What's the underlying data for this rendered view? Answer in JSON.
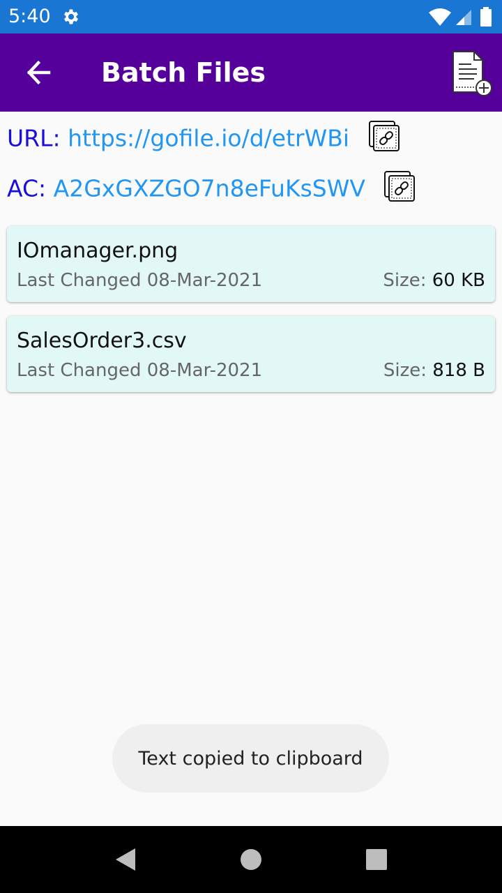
{
  "status_bar": {
    "time": "5:40",
    "icons": [
      "settings-gear-icon",
      "wifi-icon",
      "signal-icon",
      "battery-icon"
    ]
  },
  "app_bar": {
    "title": "Batch Files",
    "back_icon": "arrow-back-icon",
    "action_icon": "add-document-icon",
    "background": "#55009a"
  },
  "links": {
    "url_label": "URL:",
    "url_value": "https://gofile.io/d/etrWBi",
    "ac_label": "AC:",
    "ac_value": "A2GxGXZGO7n8eFuKsSWV",
    "copy_icon": "copy-link-icon",
    "label_color": "#1a0fd9",
    "value_color": "#2196f3"
  },
  "files": [
    {
      "name": "IOmanager.png",
      "last_changed": "Last Changed 08-Mar-2021",
      "size_label": "Size:",
      "size_value": "60 KB"
    },
    {
      "name": "SalesOrder3.csv",
      "last_changed": "Last Changed 08-Mar-2021",
      "size_label": "Size:",
      "size_value": "818 B"
    }
  ],
  "toast": {
    "message": "Text copied to clipboard"
  },
  "nav_bar": {
    "icons": [
      "nav-back-icon",
      "nav-home-icon",
      "nav-recents-icon"
    ]
  }
}
